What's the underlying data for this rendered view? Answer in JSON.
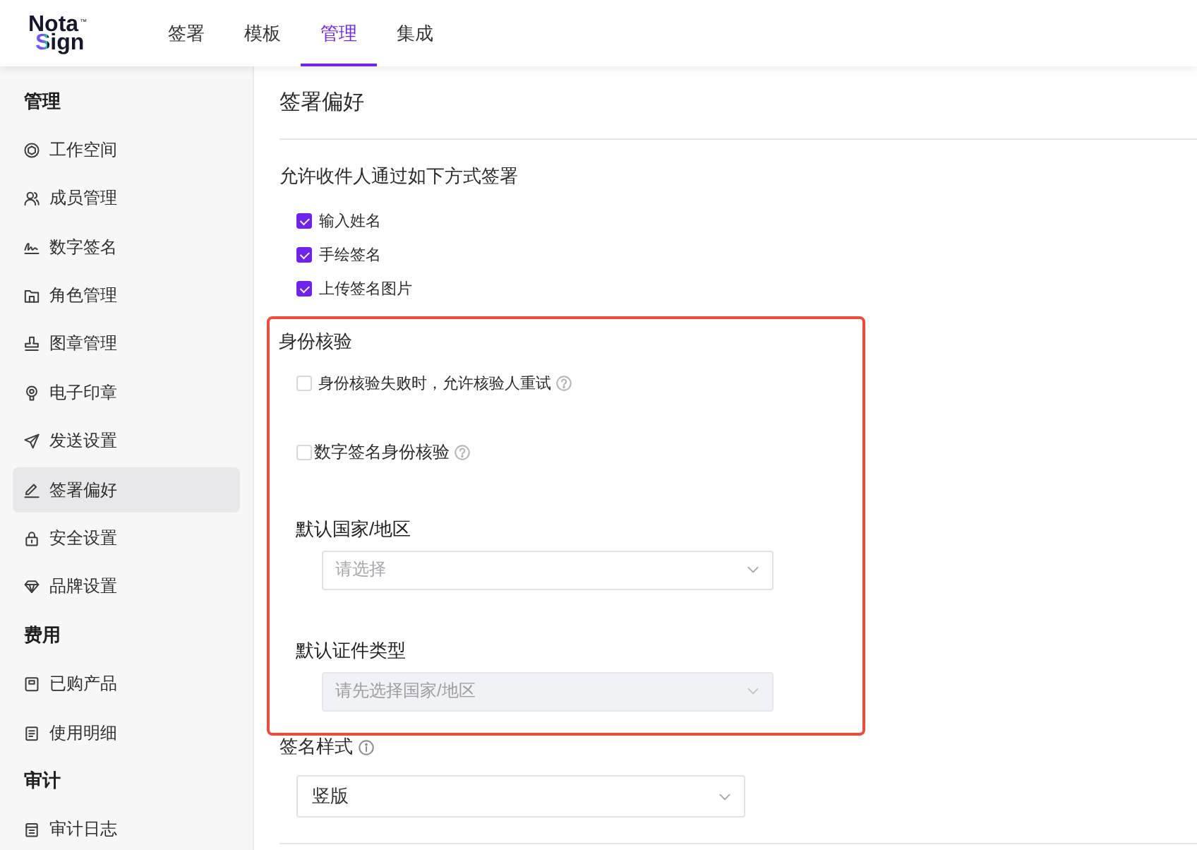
{
  "header": {
    "logo": {
      "line_1": "Nota",
      "mark": "™",
      "line_2": "Sign"
    },
    "tabs": [
      {
        "label": "签署",
        "selected": false
      },
      {
        "label": "模板",
        "selected": false
      },
      {
        "label": "管理",
        "selected": true
      },
      {
        "label": "集成",
        "selected": false
      }
    ]
  },
  "sidebar": {
    "sections": [
      {
        "title": "管理",
        "items": [
          {
            "label": "工作空间",
            "selected": false
          },
          {
            "label": "成员管理",
            "selected": false
          },
          {
            "label": "数字签名",
            "selected": false
          },
          {
            "label": "角色管理",
            "selected": false
          },
          {
            "label": "图章管理",
            "selected": false
          },
          {
            "label": "电子印章",
            "selected": false
          },
          {
            "label": "发送设置",
            "selected": false
          },
          {
            "label": "签署偏好",
            "selected": true
          },
          {
            "label": "安全设置",
            "selected": false
          },
          {
            "label": "品牌设置",
            "selected": false
          }
        ]
      },
      {
        "title": "费用",
        "items": [
          {
            "label": "已购产品",
            "selected": false
          },
          {
            "label": "使用明细",
            "selected": false
          }
        ]
      },
      {
        "title": "审计",
        "items": [
          {
            "label": "审计日志",
            "selected": false
          }
        ]
      }
    ]
  },
  "content": {
    "title": "签署偏好",
    "methods_label": "允许收件人通过如下方式签署",
    "methods": [
      {
        "label": "输入姓名",
        "checked": true
      },
      {
        "label": "手绘签名",
        "checked": true
      },
      {
        "label": "上传签名图片",
        "checked": true
      }
    ],
    "identity": {
      "highlighted": true,
      "title": "身份核验",
      "options": [
        {
          "label": "身份核验失败时，允许核验人重试",
          "checked": false,
          "help": true
        },
        {
          "label": "数字签名身份核验",
          "checked": false,
          "help": true
        }
      ],
      "fields": [
        {
          "label": "默认国家/地区",
          "placeholder": "请选择",
          "disabled": false
        },
        {
          "label": "默认证件类型",
          "placeholder": "请先选择国家/地区",
          "disabled": true
        }
      ]
    },
    "signature_style": {
      "label": "签名样式",
      "info": true,
      "value": "竖版"
    }
  }
}
